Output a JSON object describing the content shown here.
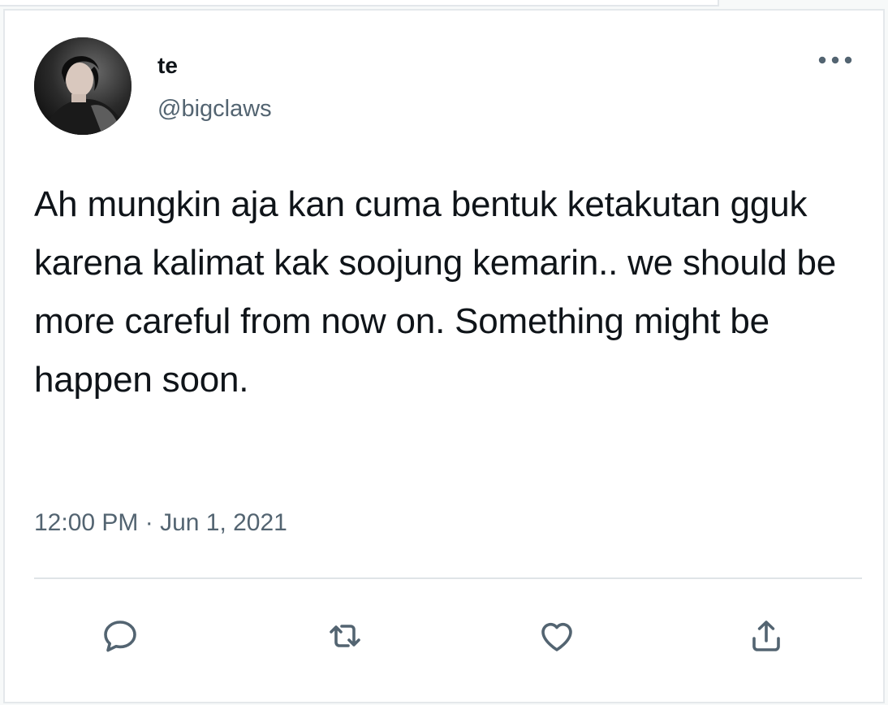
{
  "tweet": {
    "author": {
      "display_name": "te",
      "handle": "@bigclaws"
    },
    "text": "Ah mungkin aja kan cuma bentuk ketakutan gguk karena kalimat kak soojung kemarin.. we should be more careful from now on. Something might be happen soon.",
    "timestamp": "12:00 PM · Jun 1, 2021"
  },
  "actions": {
    "icons": [
      "reply-icon",
      "retweet-icon",
      "like-icon",
      "share-icon"
    ]
  },
  "colors": {
    "text_primary": "#0f1419",
    "text_secondary": "#536471",
    "divider": "#dfe4e7",
    "background": "#ffffff"
  }
}
